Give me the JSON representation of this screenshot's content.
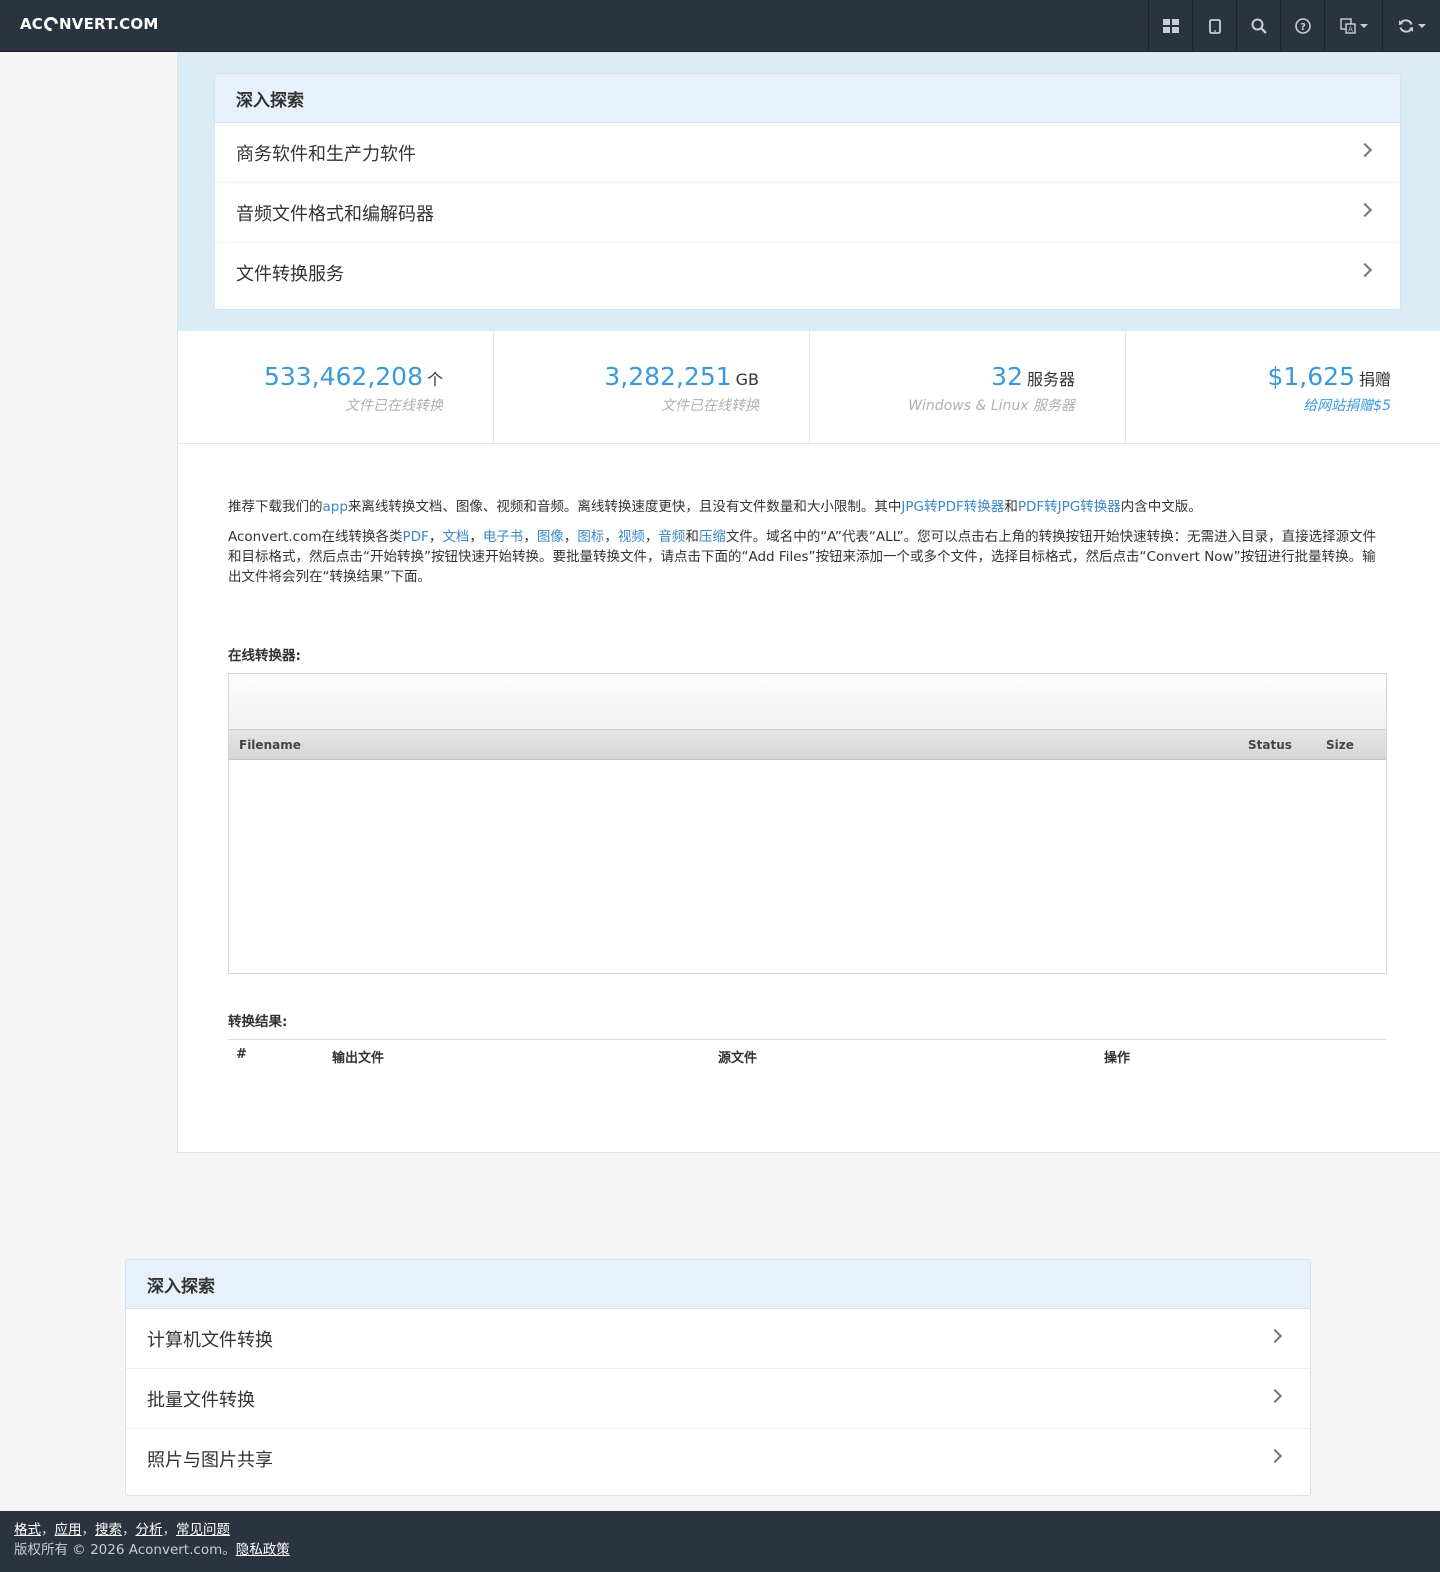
{
  "brand": {
    "prefix": "AC",
    "suffix": "NVERT.COM"
  },
  "nav": {
    "icons": [
      "grid-icon",
      "tablet-icon",
      "search-icon",
      "help-icon",
      "language-icon",
      "refresh-icon"
    ]
  },
  "explore_top": {
    "title": "深入探索",
    "items": [
      "商务软件和生产力软件",
      "音频文件格式和编解码器",
      "文件转换服务"
    ]
  },
  "stats": [
    {
      "number": "533,462,208",
      "unit": "个",
      "sub": "文件已在线转换"
    },
    {
      "number": "3,282,251",
      "unit": "GB",
      "sub": "文件已在线转换"
    },
    {
      "number": "32",
      "unit": "服务器",
      "sub": "Windows & Linux 服务器"
    },
    {
      "number": "$1,625",
      "unit": "捐赠",
      "sub": "给网站捐赠$5"
    }
  ],
  "intro": {
    "p1_a": "推荐下载我们的",
    "p1_link1": "app",
    "p1_b": "来离线转换文档、图像、视频和音频。离线转换速度更快，且没有文件数量和大小限制。其中",
    "p1_link2": "JPG转PDF转换器",
    "p1_c": "和",
    "p1_link3": "PDF转JPG转换器",
    "p1_d": "内含中文版。",
    "p2_a": "Aconvert.com在线转换各类",
    "p2_links": [
      "PDF",
      "文档",
      "电子书",
      "图像",
      "图标",
      "视频",
      "音频",
      "压缩"
    ],
    "p2_sep": "，",
    "p2_and": "和",
    "p2_b": "文件。域名中的“A”代表“ALL”。您可以点击右上角的转换按钮开始快速转换：无需进入目录，直接选择源文件和目标格式，然后点击“开始转换”按钮快速开始转换。要批量转换文件，请点击下面的“Add Files”按钮来添加一个或多个文件，选择目标格式，然后点击“Convert Now”按钮进行批量转换。输出文件将会列在“转换结果”下面。"
  },
  "converter": {
    "label": "在线转换器:",
    "columns": {
      "filename": "Filename",
      "status": "Status",
      "size": "Size"
    }
  },
  "results": {
    "label": "转换结果:",
    "columns": {
      "num": "#",
      "output": "输出文件",
      "source": "源文件",
      "action": "操作"
    }
  },
  "explore_bottom": {
    "title": "深入探索",
    "items": [
      "计算机文件转换",
      "批量文件转换",
      "照片与图片共享"
    ]
  },
  "footer": {
    "links": [
      "格式",
      "应用",
      "搜索",
      "分析",
      "常见问题"
    ],
    "sep": "，",
    "copyright": "版权所有 © 2026 Aconvert.com。",
    "privacy": "隐私政策"
  }
}
